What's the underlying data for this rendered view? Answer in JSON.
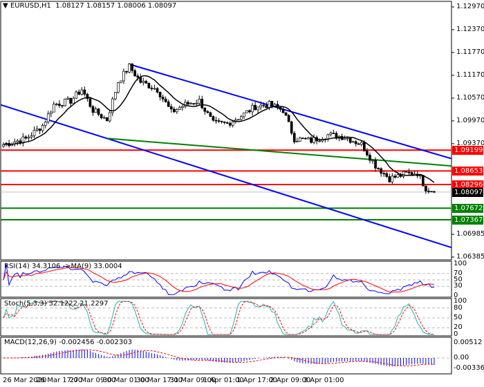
{
  "header": {
    "symbol": "EURUSD,H1",
    "open": "1.08127",
    "high": "1.08157",
    "low": "1.08006",
    "close": "1.08097"
  },
  "price_axis": [
    "1.12970",
    "1.12370",
    "1.11770",
    "1.11170",
    "1.10570",
    "1.09970",
    "1.09370",
    "1.06985",
    "1.06385"
  ],
  "levels": [
    {
      "label": "1.09199",
      "price": 1.09199,
      "color": "#ff0000"
    },
    {
      "label": "1.08653",
      "price": 1.08653,
      "color": "#ff0000"
    },
    {
      "label": "1.08296",
      "price": 1.08296,
      "color": "#ff0000"
    },
    {
      "label": "1.07672",
      "price": 1.07672,
      "color": "#008000"
    },
    {
      "label": "1.07367",
      "price": 1.07367,
      "color": "#008000"
    }
  ],
  "current": {
    "label": "1.08097",
    "price": 1.08097
  },
  "time_axis": [
    "26 Mar 2020",
    "26 Mar 17:00",
    "27 Mar 09:00",
    "30 Mar 01:00",
    "30 Mar 17:00",
    "31 Mar 09:00",
    "1 Apr 01:00",
    "1 Apr 17:00",
    "2 Apr 09:00",
    "3 Apr 01:00"
  ],
  "rsi": {
    "label": "RSI(14) 34.3106",
    "ma_label": "->MA(9) 33.0004",
    "axis": [
      "100",
      "70",
      "50",
      "30",
      "0"
    ]
  },
  "stoch": {
    "label": "Stoch(5,3,3) 32.1222 21.2297",
    "axis": [
      "100",
      "80",
      "50",
      "20",
      "0"
    ]
  },
  "macd": {
    "label": "MACD(12,26,9) -0.002456 -0.002303",
    "axis": [
      "0.00512",
      "0.00",
      "-0.003361"
    ]
  },
  "chart_data": {
    "type": "candlestick",
    "price_range": [
      1.06385,
      1.1297
    ],
    "waypoints": [
      [
        0,
        1.0935
      ],
      [
        8,
        1.095
      ],
      [
        14,
        1.0985
      ],
      [
        18,
        1.104
      ],
      [
        24,
        1.105
      ],
      [
        28,
        1.108
      ],
      [
        32,
        1.1025
      ],
      [
        37,
        1.1
      ],
      [
        41,
        1.11
      ],
      [
        45,
        1.114
      ],
      [
        49,
        1.11
      ],
      [
        55,
        1.108
      ],
      [
        60,
        1.102
      ],
      [
        65,
        1.104
      ],
      [
        70,
        1.105
      ],
      [
        75,
        1.099
      ],
      [
        80,
        1.099
      ],
      [
        85,
        1.101
      ],
      [
        90,
        1.1035
      ],
      [
        95,
        1.104
      ],
      [
        100,
        1.1025
      ],
      [
        104,
        1.095
      ],
      [
        110,
        1.0945
      ],
      [
        116,
        1.096
      ],
      [
        122,
        1.0955
      ],
      [
        128,
        1.0935
      ],
      [
        133,
        1.088
      ],
      [
        138,
        1.0845
      ],
      [
        144,
        1.0858
      ],
      [
        148,
        1.086
      ],
      [
        151,
        1.082
      ],
      [
        154,
        1.0812
      ]
    ],
    "candle_count": 155,
    "trendlines": [
      {
        "color": "#0000ff",
        "from": [
          45,
          1.1146
        ],
        "to": [
          154,
          1.0911
        ]
      },
      {
        "color": "#0000ff",
        "from": [
          0,
          1.1037
        ],
        "to": [
          154,
          1.0678
        ]
      },
      {
        "color": "#008000",
        "from": [
          37,
          1.0951
        ],
        "to": [
          154,
          1.0882
        ]
      }
    ]
  }
}
